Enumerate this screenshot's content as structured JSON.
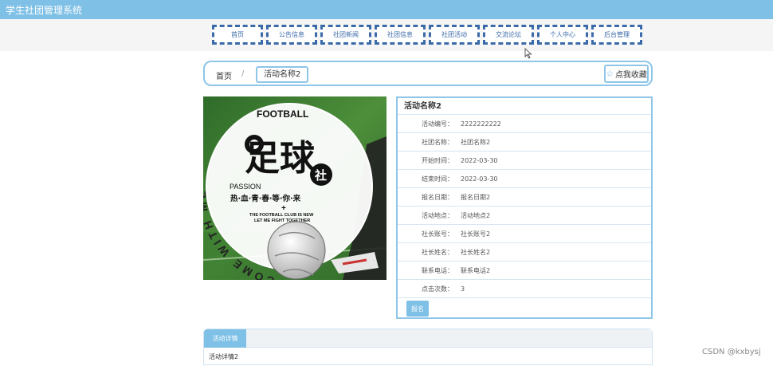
{
  "header": {
    "title": "学生社团管理系统"
  },
  "nav": {
    "items": [
      {
        "label": "首页"
      },
      {
        "label": "公告信息"
      },
      {
        "label": "社团新闻"
      },
      {
        "label": "社团信息"
      },
      {
        "label": "社团活动"
      },
      {
        "label": "交流论坛"
      },
      {
        "label": "个人中心"
      },
      {
        "label": "后台管理"
      }
    ]
  },
  "breadcrumb": {
    "home": "首页",
    "separator": "/",
    "current": "活动名称2"
  },
  "favorite": {
    "label": "点我收藏",
    "icon": "star-icon"
  },
  "poster": {
    "brand": "FOOTBALL",
    "headline": "足球",
    "badge": "社",
    "passion": "PASSION",
    "slogan": "热·血·青·春·等·你·来",
    "plus": "+",
    "line1": "THE FOOTBALL CLUB IS NEW",
    "line2": "LET ME FIGHT TOGETHER",
    "ring_text": "COME WITH ME"
  },
  "activity": {
    "name": "活动名称2",
    "fields": [
      {
        "label": "活动编号：",
        "value": "2222222222"
      },
      {
        "label": "社团名称：",
        "value": "社团名称2"
      },
      {
        "label": "开始时间：",
        "value": "2022-03-30"
      },
      {
        "label": "结束时间：",
        "value": "2022-03-30"
      },
      {
        "label": "报名日期：",
        "value": "报名日期2"
      },
      {
        "label": "活动地点：",
        "value": "活动地点2"
      },
      {
        "label": "社长账号：",
        "value": "社长账号2"
      },
      {
        "label": "社长姓名：",
        "value": "社长姓名2"
      },
      {
        "label": "联系电话：",
        "value": "联系电话2"
      },
      {
        "label": "点击次数：",
        "value": "3"
      }
    ],
    "signup_label": "报名"
  },
  "detail": {
    "tab_label": "活动详情",
    "content": "活动详情2"
  },
  "watermark": "CSDN @kxbysj",
  "colors": {
    "accent": "#7ec0e6",
    "nav_border": "#3b6aa8",
    "panel_border": "#8ec6e8"
  }
}
